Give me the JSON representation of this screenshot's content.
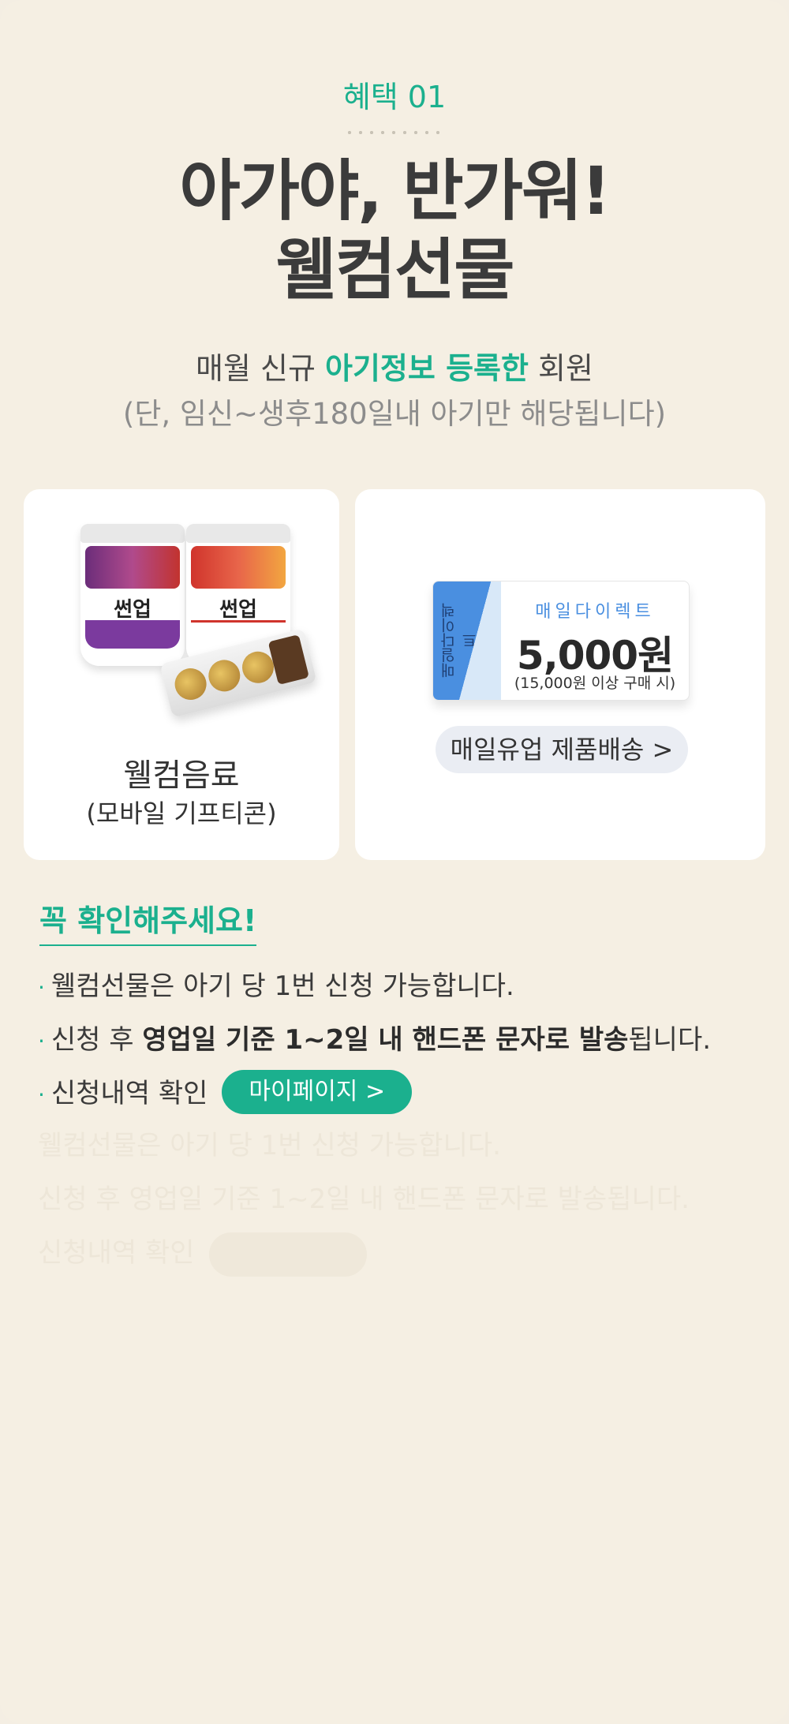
{
  "header": {
    "benefit_tag": "혜택 01",
    "title_line1": "아가야, 반가워!",
    "title_line2": "웰컴선물",
    "subtitle_pre": "매월 신규 ",
    "subtitle_highlight": "아기정보 등록한",
    "subtitle_post": " 회원",
    "note": "(단, 임신~생후180일내 아기만 해당됩니다)"
  },
  "gift_card": {
    "cup_brand": "썬업",
    "name": "웰컴음료",
    "sub": "(모바일 기프티콘)"
  },
  "coupon_card": {
    "vertical_text": "매일다이렉트",
    "brand": "매일다이렉트",
    "amount": "5,000원",
    "condition": "(15,000원 이상 구매 시)",
    "ship_button": "매일유업 제품배송 >"
  },
  "check": {
    "title": "꼭 확인해주세요!",
    "bullet1": "웰컴선물은 아기 당 1번 신청 가능합니다.",
    "bullet2_pre": "신청 후 ",
    "bullet2_bold": "영업일 기준 1~2일 내 핸드폰 문자로 발송",
    "bullet2_post": "됩니다.",
    "bullet3": "신청내역 확인",
    "mypage_button": "마이페이지 >"
  },
  "colors": {
    "accent": "#1bb08e",
    "background": "#f5efe3",
    "coupon_blue": "#4a8fe0",
    "button_gray": "#eaedf3"
  }
}
